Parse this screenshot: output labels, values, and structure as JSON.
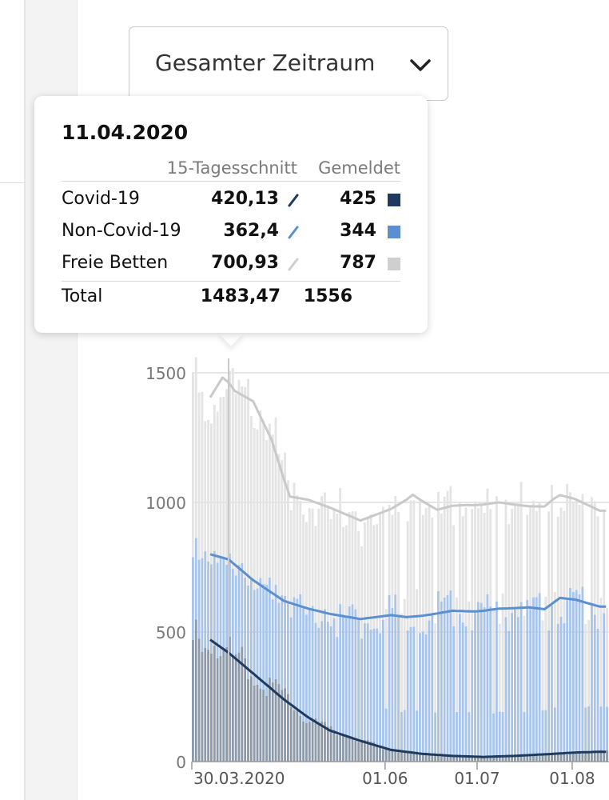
{
  "dropdown": {
    "label": "Gesamter Zeitraum"
  },
  "tooltip": {
    "date": "11.04.2020",
    "col_avg": "15-Tagesschnitt",
    "col_reported": "Gemeldet",
    "rows": [
      {
        "name": "Covid-19",
        "avg": "420,13",
        "reported": "425",
        "color": "#1f3a5f"
      },
      {
        "name": "Non-Covid-19",
        "avg": "362,4",
        "reported": "344",
        "color": "#5b8fd0"
      },
      {
        "name": "Freie Betten",
        "avg": "700,93",
        "reported": "787",
        "color": "#cfcfcf"
      }
    ],
    "total": {
      "name": "Total",
      "avg": "1483,47",
      "reported": "1556"
    }
  },
  "chart_data": {
    "type": "bar",
    "stacked": true,
    "title": "",
    "xlabel": "",
    "ylabel": "",
    "ylim": [
      0,
      1600
    ],
    "y_ticks": [
      0,
      500,
      1000,
      1500
    ],
    "y_tick_labels": [
      "0",
      "500",
      "1000",
      "1500"
    ],
    "x_tick_labels": [
      "30.03.2020",
      "01.06",
      "01.07",
      "01.08"
    ],
    "grid": true,
    "x_start_label": "30.03.2020",
    "x_ticks": [
      {
        "label": "30.03.2020",
        "day": 0
      },
      {
        "label": "01.06",
        "day": 63
      },
      {
        "label": "01.07",
        "day": 93
      },
      {
        "label": "01.08",
        "day": 124
      }
    ],
    "series": [
      {
        "name": "Covid-19",
        "color": "#1f3a5f",
        "bar_color": "#8d9aaa",
        "avg_points": [
          [
            6,
            470
          ],
          [
            12,
            420
          ],
          [
            20,
            340
          ],
          [
            30,
            240
          ],
          [
            38,
            170
          ],
          [
            45,
            120
          ],
          [
            55,
            80
          ],
          [
            65,
            45
          ],
          [
            75,
            30
          ],
          [
            85,
            22
          ],
          [
            95,
            18
          ],
          [
            105,
            22
          ],
          [
            115,
            28
          ],
          [
            125,
            35
          ],
          [
            133,
            38
          ]
        ]
      },
      {
        "name": "Non-Covid-19",
        "color": "#5b8fd0",
        "bar_color": "#a8c4e8",
        "avg_points": [
          [
            6,
            330
          ],
          [
            12,
            360
          ],
          [
            20,
            360
          ],
          [
            30,
            380
          ],
          [
            38,
            420
          ],
          [
            45,
            450
          ],
          [
            55,
            470
          ],
          [
            65,
            520
          ],
          [
            70,
            520
          ],
          [
            78,
            540
          ],
          [
            85,
            560
          ],
          [
            92,
            560
          ],
          [
            100,
            570
          ],
          [
            110,
            570
          ],
          [
            115,
            560
          ],
          [
            120,
            600
          ],
          [
            125,
            590
          ],
          [
            133,
            560
          ]
        ]
      },
      {
        "name": "Freie Betten",
        "color": "#c9c9c9",
        "bar_color": "#e4e4e4",
        "avg_points": [
          [
            6,
            605
          ],
          [
            10,
            695
          ],
          [
            14,
            670
          ],
          [
            20,
            690
          ],
          [
            26,
            590
          ],
          [
            32,
            410
          ],
          [
            38,
            420
          ],
          [
            45,
            410
          ],
          [
            55,
            380
          ],
          [
            65,
            410
          ],
          [
            72,
            470
          ],
          [
            80,
            400
          ],
          [
            90,
            410
          ],
          [
            100,
            410
          ],
          [
            110,
            390
          ],
          [
            118,
            400
          ],
          [
            124,
            390
          ],
          [
            133,
            370
          ]
        ]
      }
    ]
  }
}
